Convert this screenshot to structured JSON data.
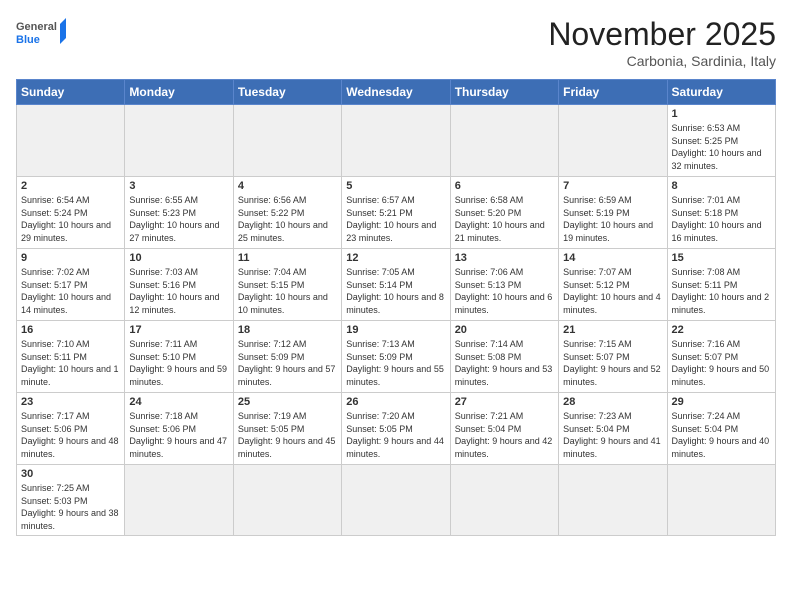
{
  "header": {
    "logo_general": "General",
    "logo_blue": "Blue",
    "month": "November 2025",
    "location": "Carbonia, Sardinia, Italy"
  },
  "days_of_week": [
    "Sunday",
    "Monday",
    "Tuesday",
    "Wednesday",
    "Thursday",
    "Friday",
    "Saturday"
  ],
  "weeks": [
    [
      {
        "day": "",
        "info": ""
      },
      {
        "day": "",
        "info": ""
      },
      {
        "day": "",
        "info": ""
      },
      {
        "day": "",
        "info": ""
      },
      {
        "day": "",
        "info": ""
      },
      {
        "day": "",
        "info": ""
      },
      {
        "day": "1",
        "info": "Sunrise: 6:53 AM\nSunset: 5:25 PM\nDaylight: 10 hours and 32 minutes."
      }
    ],
    [
      {
        "day": "2",
        "info": "Sunrise: 6:54 AM\nSunset: 5:24 PM\nDaylight: 10 hours and 29 minutes."
      },
      {
        "day": "3",
        "info": "Sunrise: 6:55 AM\nSunset: 5:23 PM\nDaylight: 10 hours and 27 minutes."
      },
      {
        "day": "4",
        "info": "Sunrise: 6:56 AM\nSunset: 5:22 PM\nDaylight: 10 hours and 25 minutes."
      },
      {
        "day": "5",
        "info": "Sunrise: 6:57 AM\nSunset: 5:21 PM\nDaylight: 10 hours and 23 minutes."
      },
      {
        "day": "6",
        "info": "Sunrise: 6:58 AM\nSunset: 5:20 PM\nDaylight: 10 hours and 21 minutes."
      },
      {
        "day": "7",
        "info": "Sunrise: 6:59 AM\nSunset: 5:19 PM\nDaylight: 10 hours and 19 minutes."
      },
      {
        "day": "8",
        "info": "Sunrise: 7:01 AM\nSunset: 5:18 PM\nDaylight: 10 hours and 16 minutes."
      }
    ],
    [
      {
        "day": "9",
        "info": "Sunrise: 7:02 AM\nSunset: 5:17 PM\nDaylight: 10 hours and 14 minutes."
      },
      {
        "day": "10",
        "info": "Sunrise: 7:03 AM\nSunset: 5:16 PM\nDaylight: 10 hours and 12 minutes."
      },
      {
        "day": "11",
        "info": "Sunrise: 7:04 AM\nSunset: 5:15 PM\nDaylight: 10 hours and 10 minutes."
      },
      {
        "day": "12",
        "info": "Sunrise: 7:05 AM\nSunset: 5:14 PM\nDaylight: 10 hours and 8 minutes."
      },
      {
        "day": "13",
        "info": "Sunrise: 7:06 AM\nSunset: 5:13 PM\nDaylight: 10 hours and 6 minutes."
      },
      {
        "day": "14",
        "info": "Sunrise: 7:07 AM\nSunset: 5:12 PM\nDaylight: 10 hours and 4 minutes."
      },
      {
        "day": "15",
        "info": "Sunrise: 7:08 AM\nSunset: 5:11 PM\nDaylight: 10 hours and 2 minutes."
      }
    ],
    [
      {
        "day": "16",
        "info": "Sunrise: 7:10 AM\nSunset: 5:11 PM\nDaylight: 10 hours and 1 minute."
      },
      {
        "day": "17",
        "info": "Sunrise: 7:11 AM\nSunset: 5:10 PM\nDaylight: 9 hours and 59 minutes."
      },
      {
        "day": "18",
        "info": "Sunrise: 7:12 AM\nSunset: 5:09 PM\nDaylight: 9 hours and 57 minutes."
      },
      {
        "day": "19",
        "info": "Sunrise: 7:13 AM\nSunset: 5:09 PM\nDaylight: 9 hours and 55 minutes."
      },
      {
        "day": "20",
        "info": "Sunrise: 7:14 AM\nSunset: 5:08 PM\nDaylight: 9 hours and 53 minutes."
      },
      {
        "day": "21",
        "info": "Sunrise: 7:15 AM\nSunset: 5:07 PM\nDaylight: 9 hours and 52 minutes."
      },
      {
        "day": "22",
        "info": "Sunrise: 7:16 AM\nSunset: 5:07 PM\nDaylight: 9 hours and 50 minutes."
      }
    ],
    [
      {
        "day": "23",
        "info": "Sunrise: 7:17 AM\nSunset: 5:06 PM\nDaylight: 9 hours and 48 minutes."
      },
      {
        "day": "24",
        "info": "Sunrise: 7:18 AM\nSunset: 5:06 PM\nDaylight: 9 hours and 47 minutes."
      },
      {
        "day": "25",
        "info": "Sunrise: 7:19 AM\nSunset: 5:05 PM\nDaylight: 9 hours and 45 minutes."
      },
      {
        "day": "26",
        "info": "Sunrise: 7:20 AM\nSunset: 5:05 PM\nDaylight: 9 hours and 44 minutes."
      },
      {
        "day": "27",
        "info": "Sunrise: 7:21 AM\nSunset: 5:04 PM\nDaylight: 9 hours and 42 minutes."
      },
      {
        "day": "28",
        "info": "Sunrise: 7:23 AM\nSunset: 5:04 PM\nDaylight: 9 hours and 41 minutes."
      },
      {
        "day": "29",
        "info": "Sunrise: 7:24 AM\nSunset: 5:04 PM\nDaylight: 9 hours and 40 minutes."
      }
    ],
    [
      {
        "day": "30",
        "info": "Sunrise: 7:25 AM\nSunset: 5:03 PM\nDaylight: 9 hours and 38 minutes."
      },
      {
        "day": "",
        "info": ""
      },
      {
        "day": "",
        "info": ""
      },
      {
        "day": "",
        "info": ""
      },
      {
        "day": "",
        "info": ""
      },
      {
        "day": "",
        "info": ""
      },
      {
        "day": "",
        "info": ""
      }
    ]
  ]
}
